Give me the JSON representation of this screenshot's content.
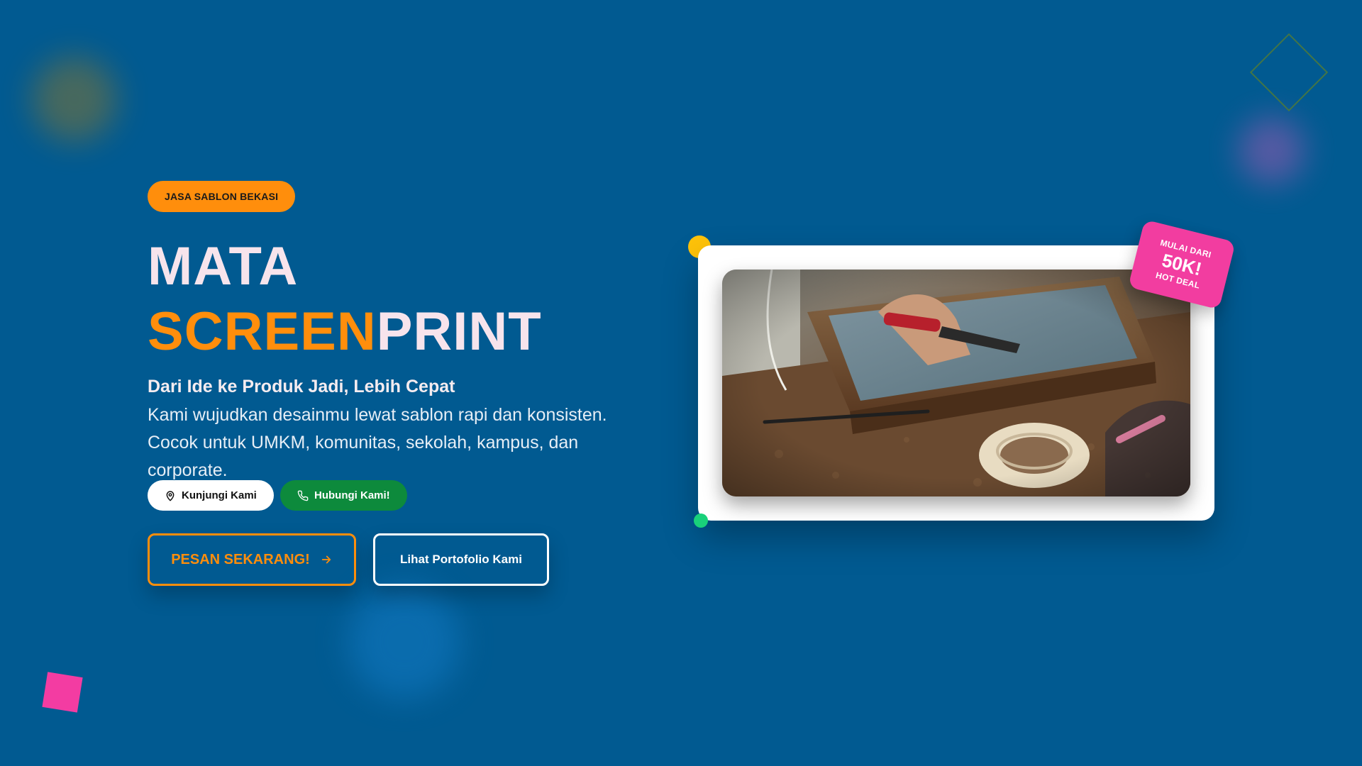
{
  "hero": {
    "badge": "JASA SABLON BEKASI",
    "title_line1": "MATA",
    "title_accent": "SCREEN",
    "title_rest": "PRINT",
    "subtitle": "Dari Ide ke Produk Jadi, Lebih Cepat",
    "description": "Kami wujudkan desainmu lewat sablon rapi dan konsisten. Cocok untuk UMKM, komunitas, sekolah, kampus, dan corporate.",
    "visit_label": "Kunjungi Kami",
    "call_label": "Hubungi Kami!",
    "order_label": "PESAN SEKARANG!",
    "portfolio_label": "Lihat Portofolio Kami"
  },
  "price_tag": {
    "top": "MULAI DARI",
    "price": "50K!",
    "bottom": "HOT DEAL"
  },
  "icons": {
    "visit": "map-pin-icon",
    "call": "phone-icon",
    "order": "arrow-right-icon"
  },
  "colors": {
    "background": "#015a91",
    "accent_orange": "#ff8e0c",
    "pink": "#f23da0",
    "green": "#0d8a3c",
    "yellow": "#ffc30a"
  }
}
